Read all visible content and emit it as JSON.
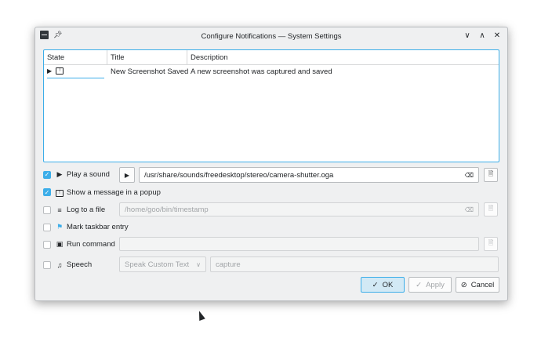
{
  "window": {
    "title": "Configure Notifications — System Settings"
  },
  "list": {
    "headers": {
      "state": "State",
      "title": "Title",
      "description": "Description"
    },
    "rows": [
      {
        "title": "New Screenshot Saved",
        "description": "A new screenshot was captured and saved"
      }
    ]
  },
  "options": {
    "play_sound": {
      "label": "Play a sound",
      "checked": true,
      "path": "/usr/share/sounds/freedesktop/stereo/camera-shutter.oga"
    },
    "popup": {
      "label": "Show a message in a popup",
      "checked": true
    },
    "log_file": {
      "label": "Log to a file",
      "checked": false,
      "path": "/home/goo/bin/timestamp"
    },
    "taskbar": {
      "label": "Mark taskbar entry",
      "checked": false
    },
    "run_command": {
      "label": "Run command",
      "checked": false,
      "command": ""
    },
    "speech": {
      "label": "Speech",
      "checked": false,
      "mode": "Speak Custom Text",
      "text": "capture"
    }
  },
  "buttons": {
    "ok": "OK",
    "apply": "Apply",
    "cancel": "Cancel"
  },
  "colors": {
    "accent": "#3daee9",
    "window_bg": "#eff0f1"
  }
}
